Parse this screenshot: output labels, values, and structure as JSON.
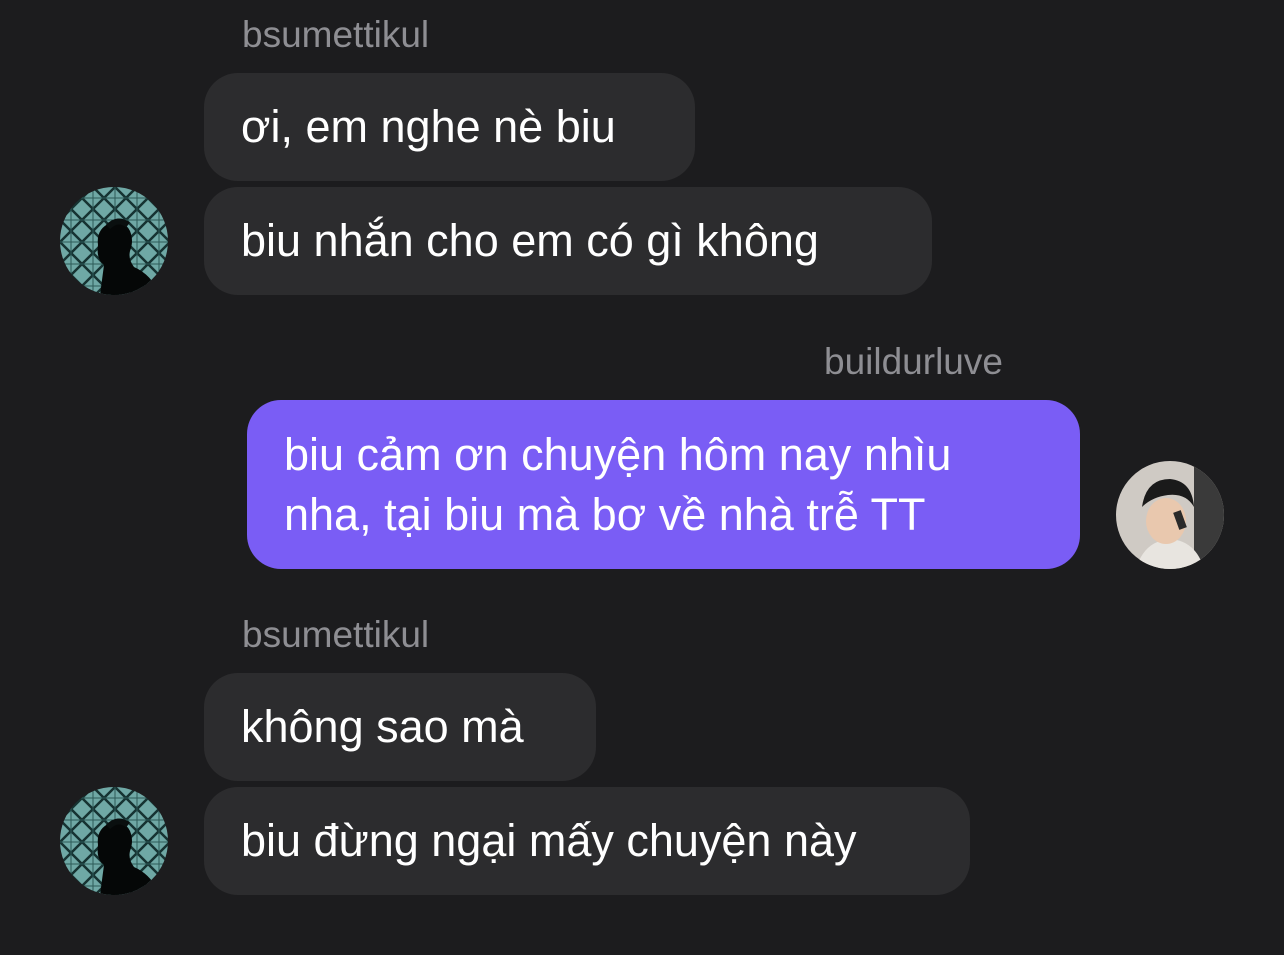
{
  "chat": {
    "colors": {
      "background": "#1c1c1e",
      "incoming_bubble": "#2c2c2e",
      "outgoing_bubble": "#7a5df5",
      "sender_name": "#8e8e93",
      "message_text": "#ffffff"
    },
    "groups": [
      {
        "sender": "bsumettikul",
        "direction": "incoming",
        "avatar_icon": "silhouette-avatar-icon",
        "messages": [
          "ơi, em nghe nè biu",
          "biu nhắn cho em có gì không"
        ]
      },
      {
        "sender": "buildurluve",
        "direction": "outgoing",
        "avatar_icon": "user-photo-avatar-icon",
        "messages": [
          "biu cảm ơn chuyện hôm nay nhìu nha, tại biu mà bơ về nhà trễ TT"
        ]
      },
      {
        "sender": "bsumettikul",
        "direction": "incoming",
        "avatar_icon": "silhouette-avatar-icon",
        "messages": [
          "không sao mà",
          "biu đừng ngại mấy chuyện này"
        ]
      }
    ]
  }
}
